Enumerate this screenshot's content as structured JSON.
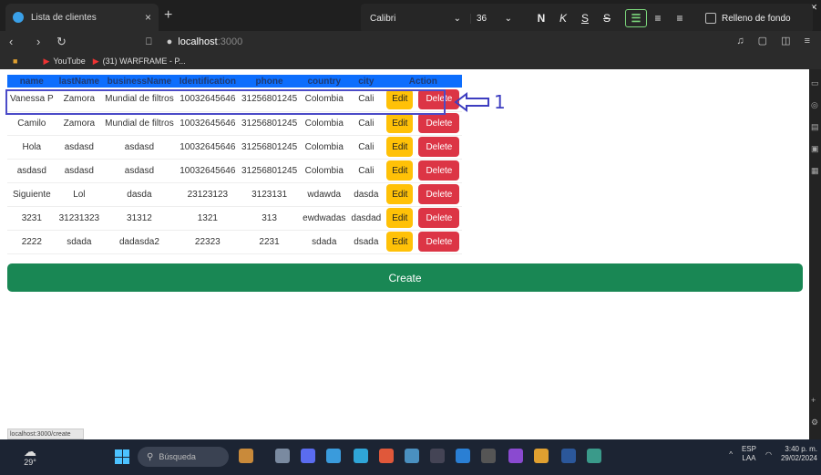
{
  "browser": {
    "tab_title": "Lista de clientes",
    "tab_close": "×",
    "new_tab": "+",
    "window_close": "×",
    "url_host": "localhost",
    "url_port": ":3000",
    "bookmarks": [
      {
        "label": "YouTube"
      },
      {
        "label": "(31) WARFRAME - P..."
      }
    ]
  },
  "format_toolbar": {
    "font_name": "Calibri",
    "font_size": "36",
    "bold": "N",
    "italic": "K",
    "underline": "S",
    "strikethrough": "S",
    "fill_label": "Relleno de fondo"
  },
  "table": {
    "headers": [
      "name",
      "lastName",
      "businessName",
      "Identification",
      "phone",
      "country",
      "city",
      "Action"
    ],
    "rows": [
      [
        "Vanessa P",
        "Zamora",
        "Mundial de filtros",
        "10032645646",
        "31256801245",
        "Colombia",
        "Cali"
      ],
      [
        "Camilo",
        "Zamora",
        "Mundial de filtros",
        "10032645646",
        "31256801245",
        "Colombia",
        "Cali"
      ],
      [
        "Hola",
        "asdasd",
        "asdasd",
        "10032645646",
        "31256801245",
        "Colombia",
        "Cali"
      ],
      [
        "asdasd",
        "asdasd",
        "asdasd",
        "10032645646",
        "31256801245",
        "Colombia",
        "Cali"
      ],
      [
        "Siguiente",
        "Lol",
        "dasda",
        "23123123",
        "3123131",
        "wdawda",
        "dasda"
      ],
      [
        "3231",
        "31231323",
        "31312",
        "1321",
        "313",
        "ewdwadas",
        "dasdad"
      ],
      [
        "2222",
        "sdada",
        "dadasda2",
        "22323",
        "2231",
        "sdada",
        "dsada"
      ]
    ],
    "edit_label": "Edit",
    "delete_label": "Delete"
  },
  "annotation": {
    "number": "1"
  },
  "create_label": "Create",
  "status_url": "localhost:3000/create",
  "taskbar": {
    "temperature": "29°",
    "search_placeholder": "Búsqueda",
    "lang_1": "ESP",
    "lang_2": "LAA",
    "time": "3:40 p. m.",
    "date": "29/02/2024"
  },
  "colors": {
    "header": "#0d6efd",
    "edit": "#ffc107",
    "delete": "#dc3545",
    "create": "#198754"
  }
}
